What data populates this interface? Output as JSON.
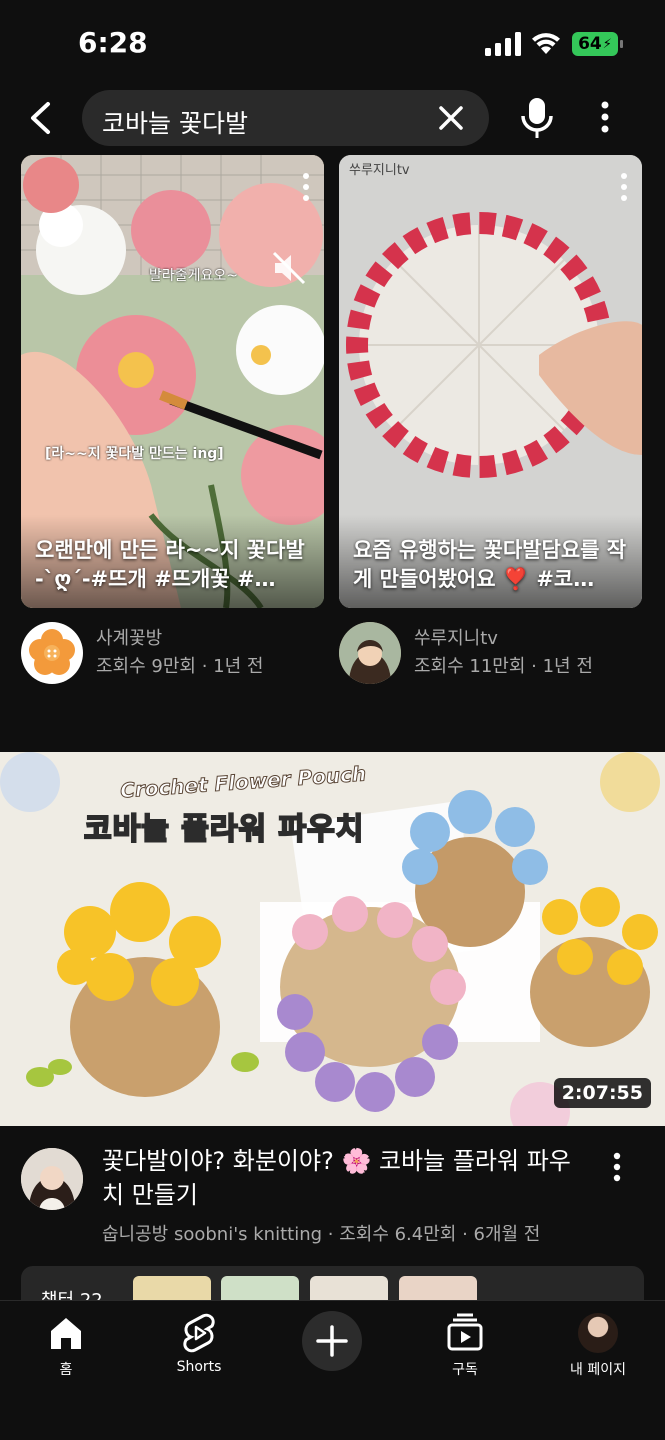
{
  "status_bar": {
    "time": "6:28",
    "battery": "64"
  },
  "search": {
    "query": "코바늘 꽃다발"
  },
  "shorts": [
    {
      "title": "오랜만에 만든 라~~지 꽃다발 -`ღ´-#뜨개 #뜨개꽃 #…",
      "overlay_text_1": "발라줄게요오~",
      "overlay_text_2": "[라~~지 꽃다발 만드는 ing]",
      "channel": "사계꽃방",
      "meta": "조회수 9만회 · 1년 전"
    },
    {
      "title": "요즘 유행하는 꽃다발담요를 작게 만들어봤어요 ❣️ #코…",
      "overlay_text_1": "쑤루지니tv",
      "channel": "쑤루지니tv",
      "meta": "조회수 11만회 · 1년 전"
    }
  ],
  "video": {
    "thumb_subtitle": "Crochet Flower Pouch",
    "thumb_title": "코바늘 플라워 파우치",
    "duration": "2:07:55",
    "title": "꽃다발이야? 화분이야? 🌸 코바늘 플라워 파우치 만들기",
    "meta": "숩니공방 soobni's knitting · 조회수 6.4만회 · 6개월 전"
  },
  "chapters": {
    "label": "챕터 22"
  },
  "nav": {
    "home": "홈",
    "shorts": "Shorts",
    "subscriptions": "구독",
    "you": "내 페이지"
  },
  "colors": {
    "background": "#0f0f0f",
    "battery": "#34c759",
    "meta_text": "#aaaaaa"
  }
}
